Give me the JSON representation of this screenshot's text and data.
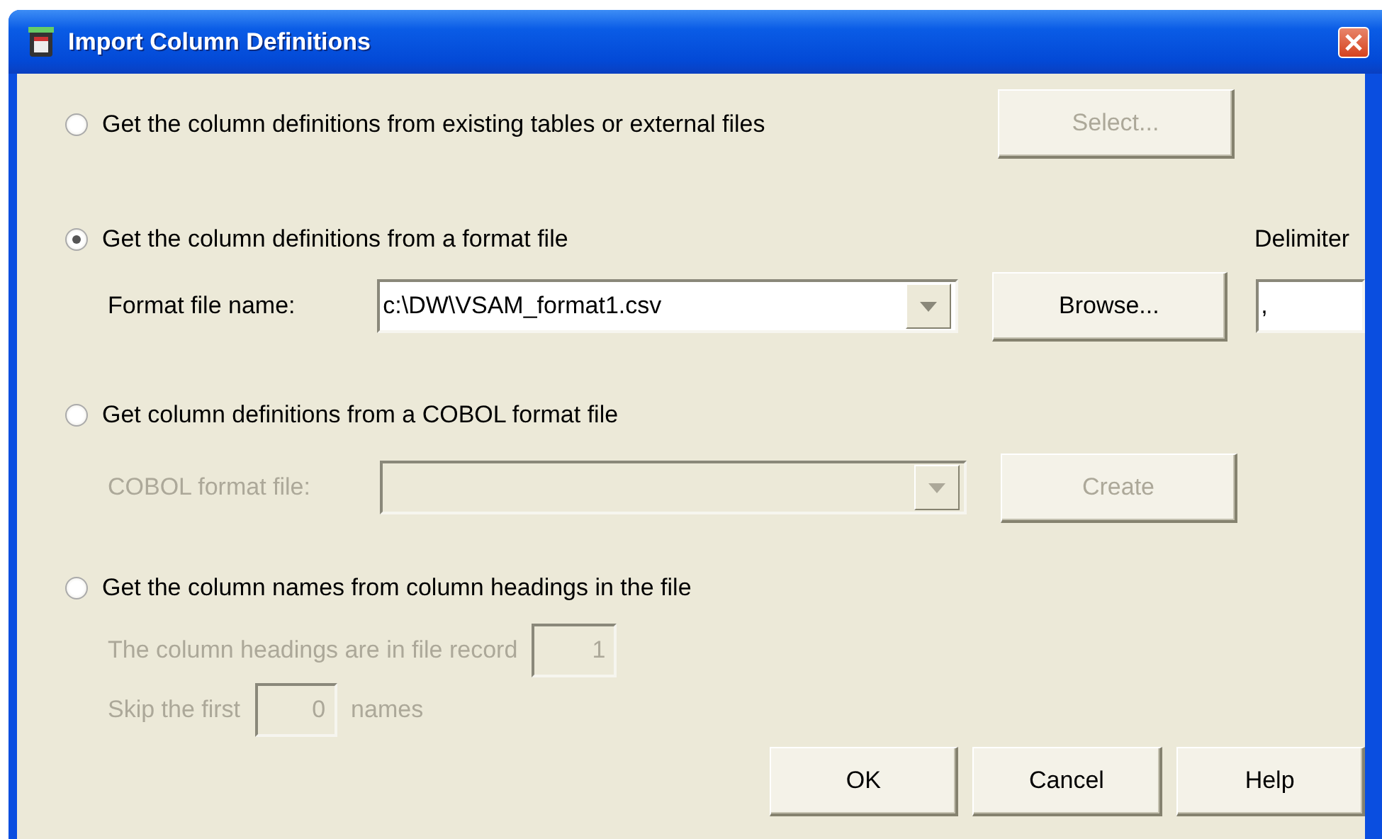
{
  "window": {
    "title": "Import Column Definitions"
  },
  "options": [
    {
      "kind": "button",
      "label": "Get the column definitions from existing tables or external files",
      "selected": false,
      "button": {
        "label": "Select...",
        "disabled": true
      }
    },
    {
      "kind": "combo",
      "label": "Get the column definitions from a format file",
      "selected": true,
      "side_label": "Delimiter",
      "field_label": "Format file name:",
      "value": "c:\\DW\\VSAM_format1.csv",
      "disabled": false,
      "button": {
        "label": "Browse...",
        "disabled": false
      },
      "side_value": ","
    },
    {
      "kind": "combo",
      "label": "Get column definitions from a COBOL format file",
      "selected": false,
      "field_label": "COBOL format file:",
      "disabled": true,
      "button": {
        "label": "Create",
        "disabled": true
      }
    },
    {
      "kind": "headings",
      "label": "Get the column names from column headings in the file",
      "selected": false,
      "disabled": true,
      "record_label": "The column headings are in file record",
      "record_value": "1",
      "skip_label": "Skip the first",
      "skip_value": "0",
      "skip_suffix": "names"
    }
  ],
  "buttons": [
    "OK",
    "Cancel",
    "Help"
  ]
}
